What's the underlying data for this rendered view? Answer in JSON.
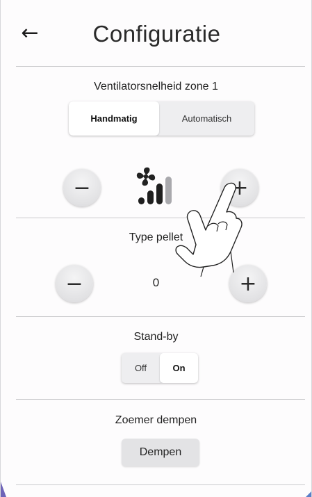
{
  "header": {
    "back_icon": "arrow-left-icon",
    "title": "Configuratie"
  },
  "fan_section": {
    "label": "Ventilatorsnelheid zone 1",
    "mode_options": [
      "Handmatig",
      "Automatisch"
    ],
    "selected_mode": "Handmatig",
    "decrease_label": "−",
    "increase_label": "+",
    "speed_icon": "fan-speed-icon",
    "speed_level": 3,
    "speed_max": 4
  },
  "pellet_section": {
    "label": "Type pellet",
    "decrease_label": "−",
    "increase_label": "+",
    "value": "0"
  },
  "standby_section": {
    "label": "Stand-by",
    "options": [
      "Off",
      "On"
    ],
    "selected": "On"
  },
  "buzzer_section": {
    "label": "Zoemer dempen",
    "button_label": "Dempen"
  },
  "colors": {
    "accent_left": "#6e63b8",
    "accent_right": "#5a7fc8"
  },
  "overlay": {
    "icon": "tap-hand-icon"
  }
}
